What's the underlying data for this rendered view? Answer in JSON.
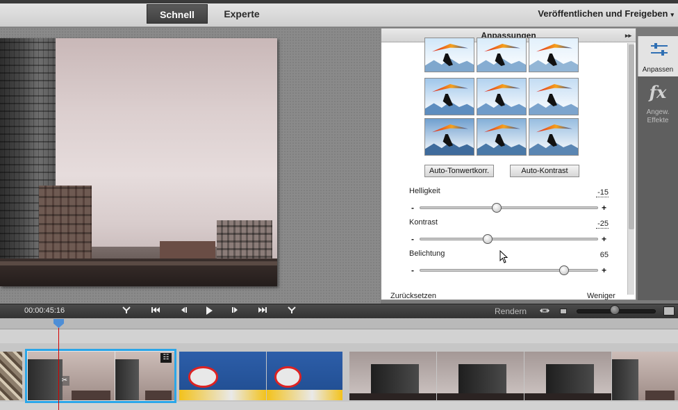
{
  "header": {
    "tabs": [
      {
        "label": "Schnell",
        "active": true
      },
      {
        "label": "Experte",
        "active": false
      }
    ],
    "publish_label": "Veröffentlichen und Freigeben",
    "publish_caret": "▾"
  },
  "panel": {
    "title": "Anpassungen",
    "collapse_glyph": "▸▸",
    "auto_tonwert_label": "Auto-Tonwertkorr.",
    "auto_kontrast_label": "Auto-Kontrast",
    "sliders": [
      {
        "label": "Helligkeit",
        "value": "-15",
        "position": 0.43
      },
      {
        "label": "Kontrast",
        "value": "-25",
        "position": 0.38
      },
      {
        "label": "Belichtung",
        "value": "65",
        "position": 0.81
      }
    ],
    "minus": "-",
    "plus": "+",
    "reset_label": "Zurücksetzen",
    "less_label": "Weniger",
    "preset_grid": [
      {
        "sky": "#cfe6f8",
        "mtn": "#7fa7cd"
      },
      {
        "sky": "#d8ebfa",
        "mtn": "#86add2"
      },
      {
        "sky": "#e2f0fb",
        "mtn": "#93b6d6"
      },
      {
        "sky": "#9fc6ea",
        "mtn": "#5d8dbf"
      },
      {
        "sky": "#b2d2ef",
        "mtn": "#6f9bc9"
      },
      {
        "sky": "#c3dcf3",
        "mtn": "#7ca4cd"
      },
      {
        "sky": "#6f9fcf",
        "mtn": "#3f6b9c"
      },
      {
        "sky": "#83afd8",
        "mtn": "#4a79a8"
      },
      {
        "sky": "#97bde0",
        "mtn": "#5a86b3"
      }
    ]
  },
  "right_toolbar": {
    "items": [
      {
        "label": "Anpassen",
        "icon": "sliders-icon",
        "active": true
      },
      {
        "label": "Angew. Effekte",
        "icon": "fx-icon",
        "active": false
      }
    ],
    "fx_glyph": "fx"
  },
  "transport": {
    "timecode": "00:00:45:16",
    "buttons": [
      {
        "name": "goto-start",
        "glyph": "Y"
      },
      {
        "name": "prev-clip",
        "glyph": "⏮"
      },
      {
        "name": "step-back",
        "glyph": "◂|"
      },
      {
        "name": "play",
        "glyph": "▶"
      },
      {
        "name": "step-forward",
        "glyph": "|▸"
      },
      {
        "name": "next-clip",
        "glyph": "⏭"
      },
      {
        "name": "goto-end",
        "glyph": "Y"
      }
    ],
    "render_label": "Rendern"
  },
  "timeline": {
    "clip_icon_glyph": "☷",
    "scissor_glyph": "✂"
  },
  "colors": {
    "selection": "#2aa6e8",
    "playhead": "#d20000",
    "playhead_marker": "#4e8ed6"
  }
}
